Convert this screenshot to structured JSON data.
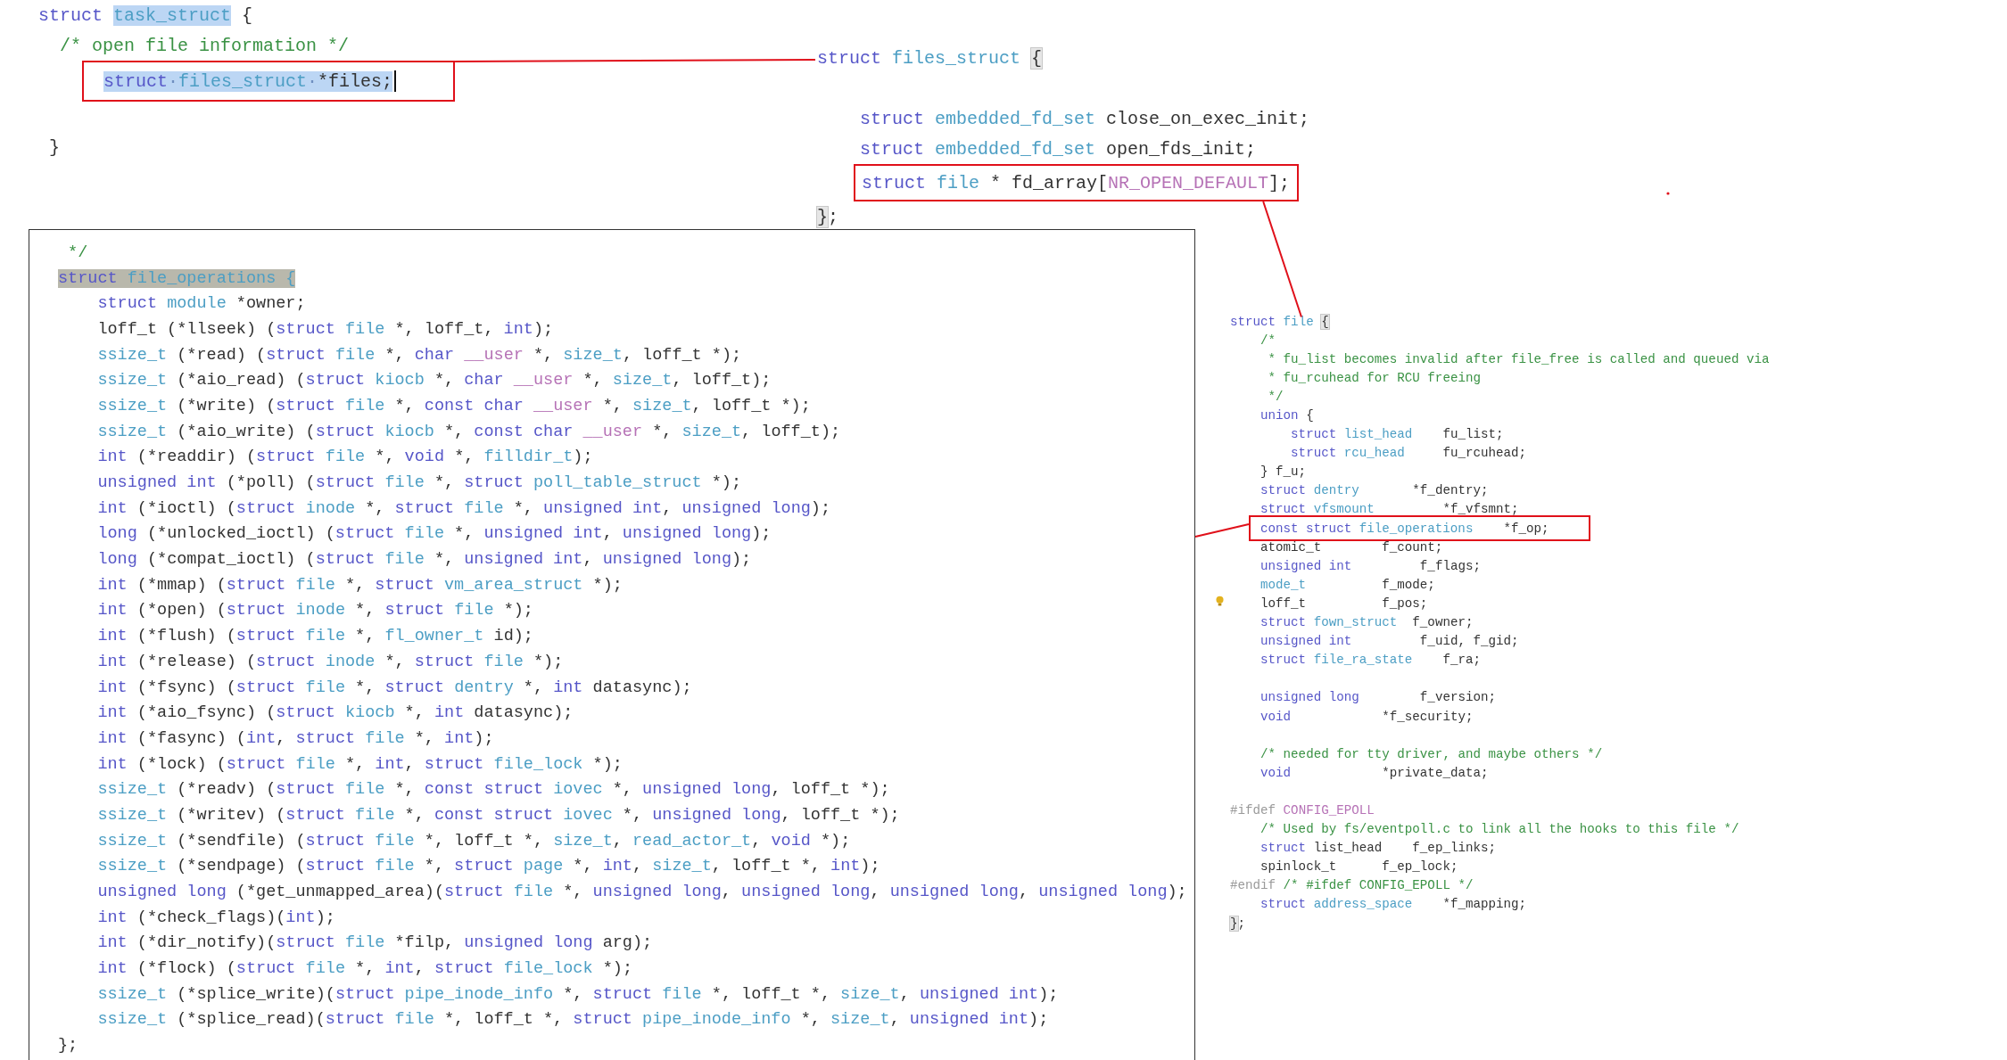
{
  "task_struct_snippet": {
    "lines": [
      [
        {
          "kind": "k",
          "text": "struct "
        },
        {
          "kind": "st",
          "text": "task_struct"
        },
        {
          "kind": "p",
          "text": " {"
        }
      ],
      [
        {
          "kind": "c",
          "text": "  /* open file information */"
        }
      ]
    ],
    "boxed_line": [
      {
        "kind": "sk",
        "text": "struct"
      },
      {
        "kind": "sw",
        "text": "·"
      },
      {
        "kind": "st",
        "text": "files_struct"
      },
      {
        "kind": "sw",
        "text": "·"
      },
      {
        "kind": "sp",
        "text": "*files;"
      },
      {
        "kind": "caret"
      }
    ],
    "lines_after": [
      [
        {
          "kind": "blank"
        }
      ],
      [
        {
          "kind": "p",
          "text": " }"
        }
      ]
    ]
  },
  "files_struct_snippet": {
    "lines": [
      [
        {
          "kind": "k",
          "text": "struct "
        },
        {
          "kind": "t",
          "text": "files_struct "
        },
        {
          "kind": "x",
          "text": "{"
        }
      ],
      [
        {
          "kind": "blank"
        }
      ],
      [
        {
          "kind": "k",
          "text": "    struct "
        },
        {
          "kind": "t",
          "text": "embedded_fd_set "
        },
        {
          "kind": "p",
          "text": "close_on_exec_init;"
        }
      ],
      [
        {
          "kind": "k",
          "text": "    struct "
        },
        {
          "kind": "t",
          "text": "embedded_fd_set "
        },
        {
          "kind": "p",
          "text": "open_fds_init;"
        }
      ]
    ],
    "boxed_line": [
      {
        "kind": "k",
        "text": "struct "
      },
      {
        "kind": "t",
        "text": "file "
      },
      {
        "kind": "p",
        "text": "* fd_array["
      },
      {
        "kind": "m",
        "text": "NR_OPEN_DEFAULT"
      },
      {
        "kind": "p",
        "text": "];"
      }
    ],
    "lines_after": [
      [
        {
          "kind": "x",
          "text": "}"
        },
        {
          "kind": "p",
          "text": ";"
        }
      ]
    ]
  },
  "file_operations_panel": {
    "lines": [
      [
        {
          "kind": "c",
          "text": " */"
        }
      ],
      [
        {
          "kind": "hk",
          "text": "struct "
        },
        {
          "kind": "ht",
          "text": "file_operations {"
        }
      ],
      [
        {
          "kind": "k",
          "text": "    struct "
        },
        {
          "kind": "t",
          "text": "module "
        },
        {
          "kind": "p",
          "text": "*owner;"
        }
      ],
      [
        {
          "kind": "p",
          "text": "    loff_t (*llseek) ("
        },
        {
          "kind": "k",
          "text": "struct "
        },
        {
          "kind": "t",
          "text": "file "
        },
        {
          "kind": "p",
          "text": "*, loff_t, "
        },
        {
          "kind": "k",
          "text": "int"
        },
        {
          "kind": "p",
          "text": ");"
        }
      ],
      [
        {
          "kind": "t",
          "text": "    ssize_t "
        },
        {
          "kind": "p",
          "text": "(*read) ("
        },
        {
          "kind": "k",
          "text": "struct "
        },
        {
          "kind": "t",
          "text": "file "
        },
        {
          "kind": "p",
          "text": "*, "
        },
        {
          "kind": "k",
          "text": "char "
        },
        {
          "kind": "m",
          "text": "__user "
        },
        {
          "kind": "p",
          "text": "*, "
        },
        {
          "kind": "t",
          "text": "size_t"
        },
        {
          "kind": "p",
          "text": ", loff_t *);"
        }
      ],
      [
        {
          "kind": "t",
          "text": "    ssize_t "
        },
        {
          "kind": "p",
          "text": "(*aio_read) ("
        },
        {
          "kind": "k",
          "text": "struct "
        },
        {
          "kind": "t",
          "text": "kiocb "
        },
        {
          "kind": "p",
          "text": "*, "
        },
        {
          "kind": "k",
          "text": "char "
        },
        {
          "kind": "m",
          "text": "__user "
        },
        {
          "kind": "p",
          "text": "*, "
        },
        {
          "kind": "t",
          "text": "size_t"
        },
        {
          "kind": "p",
          "text": ", loff_t);"
        }
      ],
      [
        {
          "kind": "t",
          "text": "    ssize_t "
        },
        {
          "kind": "p",
          "text": "(*write) ("
        },
        {
          "kind": "k",
          "text": "struct "
        },
        {
          "kind": "t",
          "text": "file "
        },
        {
          "kind": "p",
          "text": "*, "
        },
        {
          "kind": "k",
          "text": "const char "
        },
        {
          "kind": "m",
          "text": "__user "
        },
        {
          "kind": "p",
          "text": "*, "
        },
        {
          "kind": "t",
          "text": "size_t"
        },
        {
          "kind": "p",
          "text": ", loff_t *);"
        }
      ],
      [
        {
          "kind": "t",
          "text": "    ssize_t "
        },
        {
          "kind": "p",
          "text": "(*aio_write) ("
        },
        {
          "kind": "k",
          "text": "struct "
        },
        {
          "kind": "t",
          "text": "kiocb "
        },
        {
          "kind": "p",
          "text": "*, "
        },
        {
          "kind": "k",
          "text": "const char "
        },
        {
          "kind": "m",
          "text": "__user "
        },
        {
          "kind": "p",
          "text": "*, "
        },
        {
          "kind": "t",
          "text": "size_t"
        },
        {
          "kind": "p",
          "text": ", loff_t);"
        }
      ],
      [
        {
          "kind": "k",
          "text": "    int "
        },
        {
          "kind": "p",
          "text": "(*readdir) ("
        },
        {
          "kind": "k",
          "text": "struct "
        },
        {
          "kind": "t",
          "text": "file "
        },
        {
          "kind": "p",
          "text": "*, "
        },
        {
          "kind": "k",
          "text": "void "
        },
        {
          "kind": "p",
          "text": "*, "
        },
        {
          "kind": "t",
          "text": "filldir_t"
        },
        {
          "kind": "p",
          "text": ");"
        }
      ],
      [
        {
          "kind": "k",
          "text": "    unsigned int "
        },
        {
          "kind": "p",
          "text": "(*poll) ("
        },
        {
          "kind": "k",
          "text": "struct "
        },
        {
          "kind": "t",
          "text": "file "
        },
        {
          "kind": "p",
          "text": "*, "
        },
        {
          "kind": "k",
          "text": "struct "
        },
        {
          "kind": "t",
          "text": "poll_table_struct "
        },
        {
          "kind": "p",
          "text": "*);"
        }
      ],
      [
        {
          "kind": "k",
          "text": "    int "
        },
        {
          "kind": "p",
          "text": "(*ioctl) ("
        },
        {
          "kind": "k",
          "text": "struct "
        },
        {
          "kind": "t",
          "text": "inode "
        },
        {
          "kind": "p",
          "text": "*, "
        },
        {
          "kind": "k",
          "text": "struct "
        },
        {
          "kind": "t",
          "text": "file "
        },
        {
          "kind": "p",
          "text": "*, "
        },
        {
          "kind": "k",
          "text": "unsigned int"
        },
        {
          "kind": "p",
          "text": ", "
        },
        {
          "kind": "k",
          "text": "unsigned long"
        },
        {
          "kind": "p",
          "text": ");"
        }
      ],
      [
        {
          "kind": "k",
          "text": "    long "
        },
        {
          "kind": "p",
          "text": "(*unlocked_ioctl) ("
        },
        {
          "kind": "k",
          "text": "struct "
        },
        {
          "kind": "t",
          "text": "file "
        },
        {
          "kind": "p",
          "text": "*, "
        },
        {
          "kind": "k",
          "text": "unsigned int"
        },
        {
          "kind": "p",
          "text": ", "
        },
        {
          "kind": "k",
          "text": "unsigned long"
        },
        {
          "kind": "p",
          "text": ");"
        }
      ],
      [
        {
          "kind": "k",
          "text": "    long "
        },
        {
          "kind": "p",
          "text": "(*compat_ioctl) ("
        },
        {
          "kind": "k",
          "text": "struct "
        },
        {
          "kind": "t",
          "text": "file "
        },
        {
          "kind": "p",
          "text": "*, "
        },
        {
          "kind": "k",
          "text": "unsigned int"
        },
        {
          "kind": "p",
          "text": ", "
        },
        {
          "kind": "k",
          "text": "unsigned long"
        },
        {
          "kind": "p",
          "text": ");"
        }
      ],
      [
        {
          "kind": "k",
          "text": "    int "
        },
        {
          "kind": "p",
          "text": "(*mmap) ("
        },
        {
          "kind": "k",
          "text": "struct "
        },
        {
          "kind": "t",
          "text": "file "
        },
        {
          "kind": "p",
          "text": "*, "
        },
        {
          "kind": "k",
          "text": "struct "
        },
        {
          "kind": "t",
          "text": "vm_area_struct "
        },
        {
          "kind": "p",
          "text": "*);"
        }
      ],
      [
        {
          "kind": "k",
          "text": "    int "
        },
        {
          "kind": "p",
          "text": "(*open) ("
        },
        {
          "kind": "k",
          "text": "struct "
        },
        {
          "kind": "t",
          "text": "inode "
        },
        {
          "kind": "p",
          "text": "*, "
        },
        {
          "kind": "k",
          "text": "struct "
        },
        {
          "kind": "t",
          "text": "file "
        },
        {
          "kind": "p",
          "text": "*);"
        }
      ],
      [
        {
          "kind": "k",
          "text": "    int "
        },
        {
          "kind": "p",
          "text": "(*flush) ("
        },
        {
          "kind": "k",
          "text": "struct "
        },
        {
          "kind": "t",
          "text": "file "
        },
        {
          "kind": "p",
          "text": "*, "
        },
        {
          "kind": "t",
          "text": "fl_owner_t "
        },
        {
          "kind": "p",
          "text": "id);"
        }
      ],
      [
        {
          "kind": "k",
          "text": "    int "
        },
        {
          "kind": "p",
          "text": "(*release) ("
        },
        {
          "kind": "k",
          "text": "struct "
        },
        {
          "kind": "t",
          "text": "inode "
        },
        {
          "kind": "p",
          "text": "*, "
        },
        {
          "kind": "k",
          "text": "struct "
        },
        {
          "kind": "t",
          "text": "file "
        },
        {
          "kind": "p",
          "text": "*);"
        }
      ],
      [
        {
          "kind": "k",
          "text": "    int "
        },
        {
          "kind": "p",
          "text": "(*fsync) ("
        },
        {
          "kind": "k",
          "text": "struct "
        },
        {
          "kind": "t",
          "text": "file "
        },
        {
          "kind": "p",
          "text": "*, "
        },
        {
          "kind": "k",
          "text": "struct "
        },
        {
          "kind": "t",
          "text": "dentry "
        },
        {
          "kind": "p",
          "text": "*, "
        },
        {
          "kind": "k",
          "text": "int "
        },
        {
          "kind": "p",
          "text": "datasync);"
        }
      ],
      [
        {
          "kind": "k",
          "text": "    int "
        },
        {
          "kind": "p",
          "text": "(*aio_fsync) ("
        },
        {
          "kind": "k",
          "text": "struct "
        },
        {
          "kind": "t",
          "text": "kiocb "
        },
        {
          "kind": "p",
          "text": "*, "
        },
        {
          "kind": "k",
          "text": "int "
        },
        {
          "kind": "p",
          "text": "datasync);"
        }
      ],
      [
        {
          "kind": "k",
          "text": "    int "
        },
        {
          "kind": "p",
          "text": "(*fasync) ("
        },
        {
          "kind": "k",
          "text": "int"
        },
        {
          "kind": "p",
          "text": ", "
        },
        {
          "kind": "k",
          "text": "struct "
        },
        {
          "kind": "t",
          "text": "file "
        },
        {
          "kind": "p",
          "text": "*, "
        },
        {
          "kind": "k",
          "text": "int"
        },
        {
          "kind": "p",
          "text": ");"
        }
      ],
      [
        {
          "kind": "k",
          "text": "    int "
        },
        {
          "kind": "p",
          "text": "(*lock) ("
        },
        {
          "kind": "k",
          "text": "struct "
        },
        {
          "kind": "t",
          "text": "file "
        },
        {
          "kind": "p",
          "text": "*, "
        },
        {
          "kind": "k",
          "text": "int"
        },
        {
          "kind": "p",
          "text": ", "
        },
        {
          "kind": "k",
          "text": "struct "
        },
        {
          "kind": "t",
          "text": "file_lock "
        },
        {
          "kind": "p",
          "text": "*);"
        }
      ],
      [
        {
          "kind": "t",
          "text": "    ssize_t "
        },
        {
          "kind": "p",
          "text": "(*readv) ("
        },
        {
          "kind": "k",
          "text": "struct "
        },
        {
          "kind": "t",
          "text": "file "
        },
        {
          "kind": "p",
          "text": "*, "
        },
        {
          "kind": "k",
          "text": "const struct "
        },
        {
          "kind": "t",
          "text": "iovec "
        },
        {
          "kind": "p",
          "text": "*, "
        },
        {
          "kind": "k",
          "text": "unsigned long"
        },
        {
          "kind": "p",
          "text": ", loff_t *);"
        }
      ],
      [
        {
          "kind": "t",
          "text": "    ssize_t "
        },
        {
          "kind": "p",
          "text": "(*writev) ("
        },
        {
          "kind": "k",
          "text": "struct "
        },
        {
          "kind": "t",
          "text": "file "
        },
        {
          "kind": "p",
          "text": "*, "
        },
        {
          "kind": "k",
          "text": "const struct "
        },
        {
          "kind": "t",
          "text": "iovec "
        },
        {
          "kind": "p",
          "text": "*, "
        },
        {
          "kind": "k",
          "text": "unsigned long"
        },
        {
          "kind": "p",
          "text": ", loff_t *);"
        }
      ],
      [
        {
          "kind": "t",
          "text": "    ssize_t "
        },
        {
          "kind": "p",
          "text": "(*sendfile) ("
        },
        {
          "kind": "k",
          "text": "struct "
        },
        {
          "kind": "t",
          "text": "file "
        },
        {
          "kind": "p",
          "text": "*, loff_t *, "
        },
        {
          "kind": "t",
          "text": "size_t"
        },
        {
          "kind": "p",
          "text": ", "
        },
        {
          "kind": "t",
          "text": "read_actor_t"
        },
        {
          "kind": "p",
          "text": ", "
        },
        {
          "kind": "k",
          "text": "void "
        },
        {
          "kind": "p",
          "text": "*);"
        }
      ],
      [
        {
          "kind": "t",
          "text": "    ssize_t "
        },
        {
          "kind": "p",
          "text": "(*sendpage) ("
        },
        {
          "kind": "k",
          "text": "struct "
        },
        {
          "kind": "t",
          "text": "file "
        },
        {
          "kind": "p",
          "text": "*, "
        },
        {
          "kind": "k",
          "text": "struct "
        },
        {
          "kind": "t",
          "text": "page "
        },
        {
          "kind": "p",
          "text": "*, "
        },
        {
          "kind": "k",
          "text": "int"
        },
        {
          "kind": "p",
          "text": ", "
        },
        {
          "kind": "t",
          "text": "size_t"
        },
        {
          "kind": "p",
          "text": ", loff_t *, "
        },
        {
          "kind": "k",
          "text": "int"
        },
        {
          "kind": "p",
          "text": ");"
        }
      ],
      [
        {
          "kind": "k",
          "text": "    unsigned long "
        },
        {
          "kind": "p",
          "text": "(*get_unmapped_area)("
        },
        {
          "kind": "k",
          "text": "struct "
        },
        {
          "kind": "t",
          "text": "file "
        },
        {
          "kind": "p",
          "text": "*, "
        },
        {
          "kind": "k",
          "text": "unsigned long"
        },
        {
          "kind": "p",
          "text": ", "
        },
        {
          "kind": "k",
          "text": "unsigned long"
        },
        {
          "kind": "p",
          "text": ", "
        },
        {
          "kind": "k",
          "text": "unsigned long"
        },
        {
          "kind": "p",
          "text": ", "
        },
        {
          "kind": "k",
          "text": "unsigned long"
        },
        {
          "kind": "p",
          "text": ");"
        }
      ],
      [
        {
          "kind": "k",
          "text": "    int "
        },
        {
          "kind": "p",
          "text": "(*check_flags)("
        },
        {
          "kind": "k",
          "text": "int"
        },
        {
          "kind": "p",
          "text": ");"
        }
      ],
      [
        {
          "kind": "k",
          "text": "    int "
        },
        {
          "kind": "p",
          "text": "(*dir_notify)("
        },
        {
          "kind": "k",
          "text": "struct "
        },
        {
          "kind": "t",
          "text": "file "
        },
        {
          "kind": "p",
          "text": "*filp, "
        },
        {
          "kind": "k",
          "text": "unsigned long "
        },
        {
          "kind": "p",
          "text": "arg);"
        }
      ],
      [
        {
          "kind": "k",
          "text": "    int "
        },
        {
          "kind": "p",
          "text": "(*flock) ("
        },
        {
          "kind": "k",
          "text": "struct "
        },
        {
          "kind": "t",
          "text": "file "
        },
        {
          "kind": "p",
          "text": "*, "
        },
        {
          "kind": "k",
          "text": "int"
        },
        {
          "kind": "p",
          "text": ", "
        },
        {
          "kind": "k",
          "text": "struct "
        },
        {
          "kind": "t",
          "text": "file_lock "
        },
        {
          "kind": "p",
          "text": "*);"
        }
      ],
      [
        {
          "kind": "t",
          "text": "    ssize_t "
        },
        {
          "kind": "p",
          "text": "(*splice_write)("
        },
        {
          "kind": "k",
          "text": "struct "
        },
        {
          "kind": "t",
          "text": "pipe_inode_info "
        },
        {
          "kind": "p",
          "text": "*, "
        },
        {
          "kind": "k",
          "text": "struct "
        },
        {
          "kind": "t",
          "text": "file "
        },
        {
          "kind": "p",
          "text": "*, loff_t *, "
        },
        {
          "kind": "t",
          "text": "size_t"
        },
        {
          "kind": "p",
          "text": ", "
        },
        {
          "kind": "k",
          "text": "unsigned int"
        },
        {
          "kind": "p",
          "text": ");"
        }
      ],
      [
        {
          "kind": "t",
          "text": "    ssize_t "
        },
        {
          "kind": "p",
          "text": "(*splice_read)("
        },
        {
          "kind": "k",
          "text": "struct "
        },
        {
          "kind": "t",
          "text": "file "
        },
        {
          "kind": "p",
          "text": "*, loff_t *, "
        },
        {
          "kind": "k",
          "text": "struct "
        },
        {
          "kind": "t",
          "text": "pipe_inode_info "
        },
        {
          "kind": "p",
          "text": "*, "
        },
        {
          "kind": "t",
          "text": "size_t"
        },
        {
          "kind": "p",
          "text": ", "
        },
        {
          "kind": "k",
          "text": "unsigned int"
        },
        {
          "kind": "p",
          "text": ");"
        }
      ],
      [
        {
          "kind": "p",
          "text": "};"
        }
      ]
    ]
  },
  "file_struct_snippet": {
    "lines": [
      [
        {
          "kind": "k",
          "text": "struct "
        },
        {
          "kind": "t",
          "text": "file "
        },
        {
          "kind": "x",
          "text": "{"
        }
      ],
      [
        {
          "kind": "c",
          "text": "    /*"
        }
      ],
      [
        {
          "kind": "c",
          "text": "     * fu_list becomes invalid after file_free is called and queued via"
        }
      ],
      [
        {
          "kind": "c",
          "text": "     * fu_rcuhead for RCU freeing"
        }
      ],
      [
        {
          "kind": "c",
          "text": "     */"
        }
      ],
      [
        {
          "kind": "k",
          "text": "    union "
        },
        {
          "kind": "p",
          "text": "{"
        }
      ],
      [
        {
          "kind": "k",
          "text": "        struct "
        },
        {
          "kind": "t",
          "text": "list_head"
        },
        {
          "kind": "p",
          "text": "    fu_list;"
        }
      ],
      [
        {
          "kind": "k",
          "text": "        struct "
        },
        {
          "kind": "t",
          "text": "rcu_head"
        },
        {
          "kind": "p",
          "text": "     fu_rcuhead;"
        }
      ],
      [
        {
          "kind": "p",
          "text": "    } f_u;"
        }
      ],
      [
        {
          "kind": "k",
          "text": "    struct "
        },
        {
          "kind": "t",
          "text": "dentry"
        },
        {
          "kind": "p",
          "text": "       *f_dentry;"
        }
      ],
      [
        {
          "kind": "k",
          "text": "    struct "
        },
        {
          "kind": "t",
          "text": "vfsmount"
        },
        {
          "kind": "p",
          "text": "         *f_vfsmnt;"
        }
      ]
    ],
    "boxed_line": [
      {
        "kind": "k",
        "text": "const struct "
      },
      {
        "kind": "t",
        "text": "file_operations"
      },
      {
        "kind": "p",
        "text": "    *f_op;"
      }
    ],
    "lines_after": [
      [
        {
          "kind": "p",
          "text": "    atomic_t        f_count;"
        }
      ],
      [
        {
          "kind": "k",
          "text": "    unsigned int"
        },
        {
          "kind": "p",
          "text": "         f_flags;"
        }
      ],
      [
        {
          "kind": "t",
          "text": "    mode_t"
        },
        {
          "kind": "p",
          "text": "          f_mode;"
        }
      ],
      [
        {
          "kind": "bulb"
        },
        {
          "kind": "p",
          "text": "    loff_t          f_pos;"
        }
      ],
      [
        {
          "kind": "k",
          "text": "    struct "
        },
        {
          "kind": "t",
          "text": "fown_struct"
        },
        {
          "kind": "p",
          "text": "  f_owner;"
        }
      ],
      [
        {
          "kind": "k",
          "text": "    unsigned int"
        },
        {
          "kind": "p",
          "text": "         f_uid, f_gid;"
        }
      ],
      [
        {
          "kind": "k",
          "text": "    struct "
        },
        {
          "kind": "t",
          "text": "file_ra_state"
        },
        {
          "kind": "p",
          "text": "    f_ra;"
        }
      ],
      [
        {
          "kind": "blank"
        }
      ],
      [
        {
          "kind": "k",
          "text": "    unsigned long"
        },
        {
          "kind": "p",
          "text": "        f_version;"
        }
      ],
      [
        {
          "kind": "k",
          "text": "    void"
        },
        {
          "kind": "p",
          "text": "            *f_security;"
        }
      ],
      [
        {
          "kind": "blank"
        }
      ],
      [
        {
          "kind": "c",
          "text": "    /* needed for tty driver, and maybe others */"
        }
      ],
      [
        {
          "kind": "k",
          "text": "    void"
        },
        {
          "kind": "p",
          "text": "            *private_data;"
        }
      ],
      [
        {
          "kind": "blank"
        }
      ],
      [
        {
          "kind": "d",
          "text": "#ifdef "
        },
        {
          "kind": "m",
          "text": "CONFIG_EPOLL"
        }
      ],
      [
        {
          "kind": "c",
          "text": "    /* Used by fs/eventpoll.c to link all the hooks to this file */"
        }
      ],
      [
        {
          "kind": "k",
          "text": "    struct "
        },
        {
          "kind": "p",
          "text": "list_head    f_ep_links;"
        }
      ],
      [
        {
          "kind": "p",
          "text": "    spinlock_t      f_ep_lock;"
        }
      ],
      [
        {
          "kind": "d",
          "text": "#endif "
        },
        {
          "kind": "c",
          "text": "/* #ifdef CONFIG_EPOLL */"
        }
      ],
      [
        {
          "kind": "k",
          "text": "    struct "
        },
        {
          "kind": "t",
          "text": "address_space"
        },
        {
          "kind": "p",
          "text": "    *f_mapping;"
        }
      ],
      [
        {
          "kind": "x",
          "text": "}"
        },
        {
          "kind": "p",
          "text": ";"
        }
      ]
    ]
  }
}
